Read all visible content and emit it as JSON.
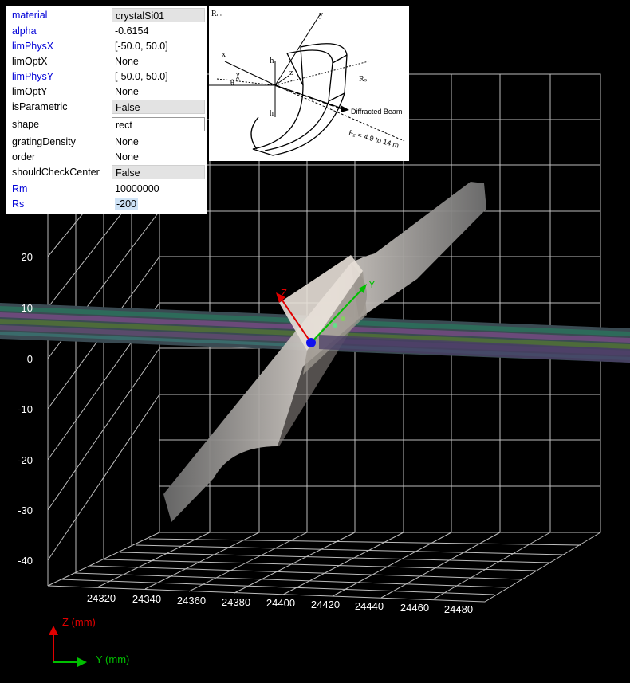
{
  "properties": [
    {
      "name": "material",
      "value": "crystalSi01",
      "name_color": "blue",
      "style": "combo"
    },
    {
      "name": "alpha",
      "value": "-0.6154",
      "name_color": "blue",
      "style": "plain"
    },
    {
      "name": "limPhysX",
      "value": "[-50.0, 50.0]",
      "name_color": "blue",
      "style": "plain"
    },
    {
      "name": "limOptX",
      "value": "None",
      "name_color": "black",
      "style": "plain"
    },
    {
      "name": "limPhysY",
      "value": "[-50.0, 50.0]",
      "name_color": "blue",
      "style": "plain"
    },
    {
      "name": "limOptY",
      "value": "None",
      "name_color": "black",
      "style": "plain"
    },
    {
      "name": "isParametric",
      "value": "False",
      "name_color": "black",
      "style": "combo"
    },
    {
      "name": "shape",
      "value": "rect",
      "name_color": "black",
      "style": "edit"
    },
    {
      "name": "gratingDensity",
      "value": "None",
      "name_color": "black",
      "style": "plain"
    },
    {
      "name": "order",
      "value": "None",
      "name_color": "black",
      "style": "plain"
    },
    {
      "name": "shouldCheckCenter",
      "value": "False",
      "name_color": "black",
      "style": "combo"
    },
    {
      "name": "Rm",
      "value": "10000000",
      "name_color": "blue",
      "style": "plain"
    },
    {
      "name": "Rs",
      "value": "-200",
      "name_color": "blue",
      "style": "selected"
    }
  ],
  "diagram": {
    "labels": {
      "y": "y",
      "x": "x",
      "z": "z",
      "chi": "χ",
      "neg_h": "-h",
      "h": "h",
      "theta": "θ",
      "r_s": "Rₛ",
      "r_m": "Rₘ",
      "beam": "Diffracted Beam",
      "f2": "F₂ = 4.9 to 14  m"
    }
  },
  "plot": {
    "z_ticks": [
      "20",
      "10",
      "0",
      "-10",
      "-20",
      "-30",
      "-40"
    ],
    "y_ticks": [
      "24320",
      "24340",
      "24360",
      "24380",
      "24400",
      "24420",
      "24440",
      "24460",
      "24480"
    ],
    "local_axes": {
      "z": "Z",
      "y": "Y"
    },
    "legend": {
      "z_label": "Z (mm)",
      "y_label": "Y (mm)"
    },
    "colors": {
      "z_axis": "#e00000",
      "y_axis": "#00d000",
      "grid": "#bdbdbd",
      "background": "#000000"
    }
  }
}
